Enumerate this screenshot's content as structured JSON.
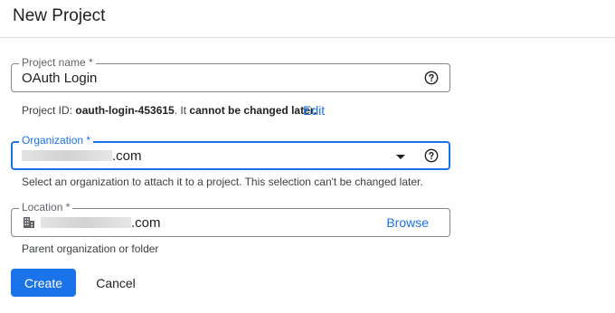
{
  "dialog": {
    "title": "New Project"
  },
  "project_name": {
    "label": "Project name *",
    "value": "OAuth Login",
    "help_icon": "help-circle-icon"
  },
  "project_id": {
    "prefix": "Project ID: ",
    "id": "oauth-login-453615",
    "middle": ". It ",
    "emphasis": "cannot be changed later.",
    "edit_label": "Edit"
  },
  "organization": {
    "label": "Organization *",
    "value_suffix": ".com",
    "dropdown_icon": "arrow-drop-down-icon",
    "help_icon": "help-circle-icon",
    "hint": "Select an organization to attach it to a project. This selection can't be changed later."
  },
  "location": {
    "label": "Location *",
    "icon": "building-icon",
    "value_suffix": ".com",
    "browse_label": "Browse",
    "hint": "Parent organization or folder"
  },
  "actions": {
    "create_label": "Create",
    "cancel_label": "Cancel"
  },
  "colors": {
    "accent": "#1a73e8",
    "border": "#80868b",
    "text": "#202124"
  }
}
